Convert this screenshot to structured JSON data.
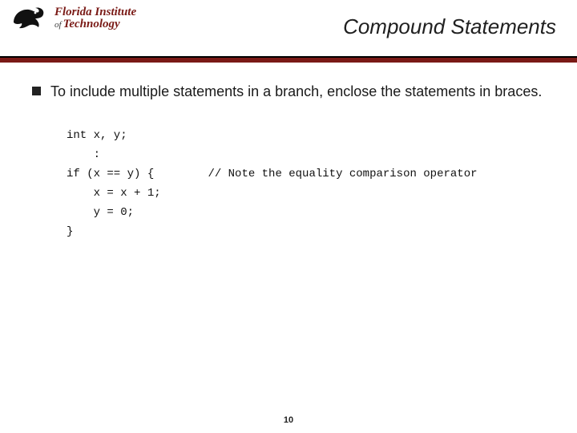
{
  "logo": {
    "line1": "Florida Institute",
    "of": "of",
    "line2_word": "Technology"
  },
  "title": "Compound Statements",
  "bullet": "To include multiple statements in a branch, enclose the statements in braces.",
  "code": {
    "l1": "int x, y;",
    "l2": "    :",
    "l3a": "if (x == y) {",
    "l3b": "// Note the equality comparison operator",
    "l4": "    x = x + 1;",
    "l5": "    y = 0;",
    "l6": "}"
  },
  "page_number": "10"
}
